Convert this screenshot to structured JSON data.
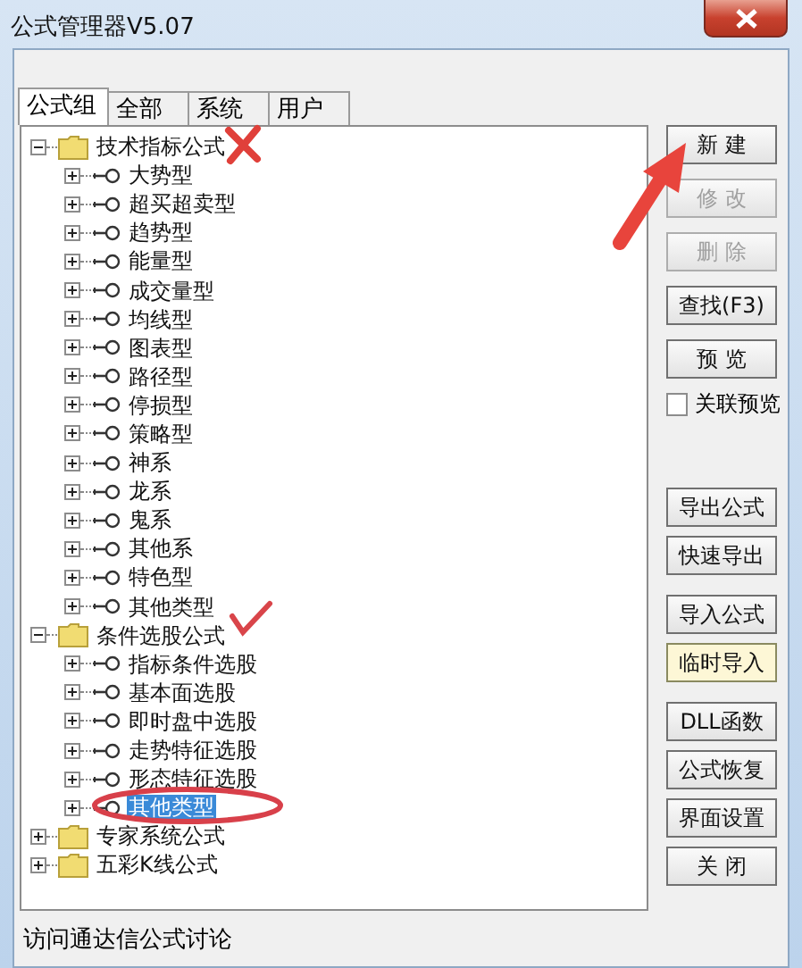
{
  "window": {
    "title": "公式管理器V5.07"
  },
  "tabs": [
    {
      "label": "公式组",
      "selected": true
    },
    {
      "label": "全部",
      "selected": false
    },
    {
      "label": "系统",
      "selected": false
    },
    {
      "label": "用户",
      "selected": false
    }
  ],
  "tree": [
    {
      "label": "技术指标公式",
      "kind": "folder",
      "expanded": true,
      "selected": false,
      "children": [
        {
          "label": "大势型",
          "kind": "formula",
          "expanded": false,
          "selected": false
        },
        {
          "label": "超买超卖型",
          "kind": "formula",
          "expanded": false,
          "selected": false
        },
        {
          "label": "趋势型",
          "kind": "formula",
          "expanded": false,
          "selected": false
        },
        {
          "label": "能量型",
          "kind": "formula",
          "expanded": false,
          "selected": false
        },
        {
          "label": "成交量型",
          "kind": "formula",
          "expanded": false,
          "selected": false
        },
        {
          "label": "均线型",
          "kind": "formula",
          "expanded": false,
          "selected": false
        },
        {
          "label": "图表型",
          "kind": "formula",
          "expanded": false,
          "selected": false
        },
        {
          "label": "路径型",
          "kind": "formula",
          "expanded": false,
          "selected": false
        },
        {
          "label": "停损型",
          "kind": "formula",
          "expanded": false,
          "selected": false
        },
        {
          "label": "策略型",
          "kind": "formula",
          "expanded": false,
          "selected": false
        },
        {
          "label": "神系",
          "kind": "formula",
          "expanded": false,
          "selected": false
        },
        {
          "label": "龙系",
          "kind": "formula",
          "expanded": false,
          "selected": false
        },
        {
          "label": "鬼系",
          "kind": "formula",
          "expanded": false,
          "selected": false
        },
        {
          "label": "其他系",
          "kind": "formula",
          "expanded": false,
          "selected": false
        },
        {
          "label": "特色型",
          "kind": "formula",
          "expanded": false,
          "selected": false
        },
        {
          "label": "其他类型",
          "kind": "formula",
          "expanded": false,
          "selected": false
        }
      ]
    },
    {
      "label": "条件选股公式",
      "kind": "folder",
      "expanded": true,
      "selected": false,
      "children": [
        {
          "label": "指标条件选股",
          "kind": "formula",
          "expanded": false,
          "selected": false
        },
        {
          "label": "基本面选股",
          "kind": "formula",
          "expanded": false,
          "selected": false
        },
        {
          "label": "即时盘中选股",
          "kind": "formula",
          "expanded": false,
          "selected": false
        },
        {
          "label": "走势特征选股",
          "kind": "formula",
          "expanded": false,
          "selected": false
        },
        {
          "label": "形态特征选股",
          "kind": "formula",
          "expanded": false,
          "selected": false
        },
        {
          "label": "其他类型",
          "kind": "formula",
          "expanded": false,
          "selected": true
        }
      ]
    },
    {
      "label": "专家系统公式",
      "kind": "folder",
      "expanded": false,
      "selected": false
    },
    {
      "label": "五彩K线公式",
      "kind": "folder",
      "expanded": false,
      "selected": false
    }
  ],
  "buttons": [
    {
      "label": "新 建",
      "disabled": false,
      "highlighted": false
    },
    {
      "label": "修 改",
      "disabled": true,
      "highlighted": false
    },
    {
      "label": "删 除",
      "disabled": true,
      "highlighted": false
    },
    {
      "label": "查找(F3)",
      "disabled": false,
      "highlighted": false
    },
    {
      "label": "预 览",
      "disabled": false,
      "highlighted": false
    }
  ],
  "preview_checkbox": {
    "label": "关联预览",
    "checked": false
  },
  "buttons_lower": [
    {
      "label": "导出公式",
      "disabled": false,
      "highlighted": false
    },
    {
      "label": "快速导出",
      "disabled": false,
      "highlighted": false
    },
    {
      "label": "导入公式",
      "disabled": false,
      "highlighted": false
    },
    {
      "label": "临时导入",
      "disabled": false,
      "highlighted": true
    },
    {
      "label": "DLL函数",
      "disabled": false,
      "highlighted": false
    },
    {
      "label": "公式恢复",
      "disabled": false,
      "highlighted": false
    },
    {
      "label": "界面设置",
      "disabled": false,
      "highlighted": false
    },
    {
      "label": "关 闭",
      "disabled": false,
      "highlighted": false
    }
  ],
  "status_bar": "访问通达信公式讨论"
}
